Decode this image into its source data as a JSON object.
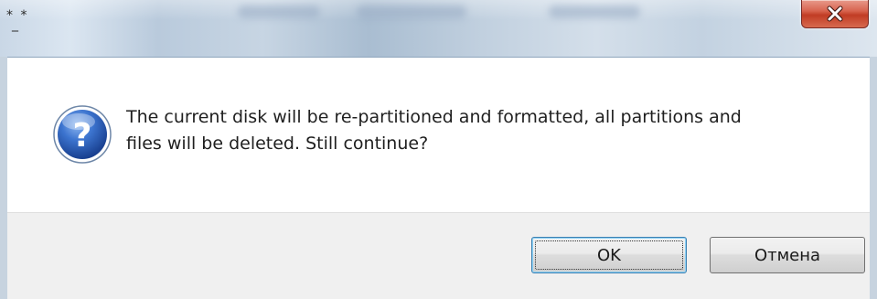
{
  "window": {
    "title": "* *\n_",
    "title_line1": "* *",
    "title_line2": "_"
  },
  "message": {
    "line1": "The current disk will be re-partitioned and formatted, all partitions and",
    "line2": "files will be deleted. Still continue?",
    "icon": "question-icon"
  },
  "buttons": {
    "ok_label": "OK",
    "cancel_label": "Отмена"
  },
  "icons": {
    "close": "close-icon",
    "question": "question-icon"
  },
  "colors": {
    "close_button": "#c13c24",
    "question_icon": "#2b5fb6",
    "ok_focus_border": "#3c7fb1"
  }
}
